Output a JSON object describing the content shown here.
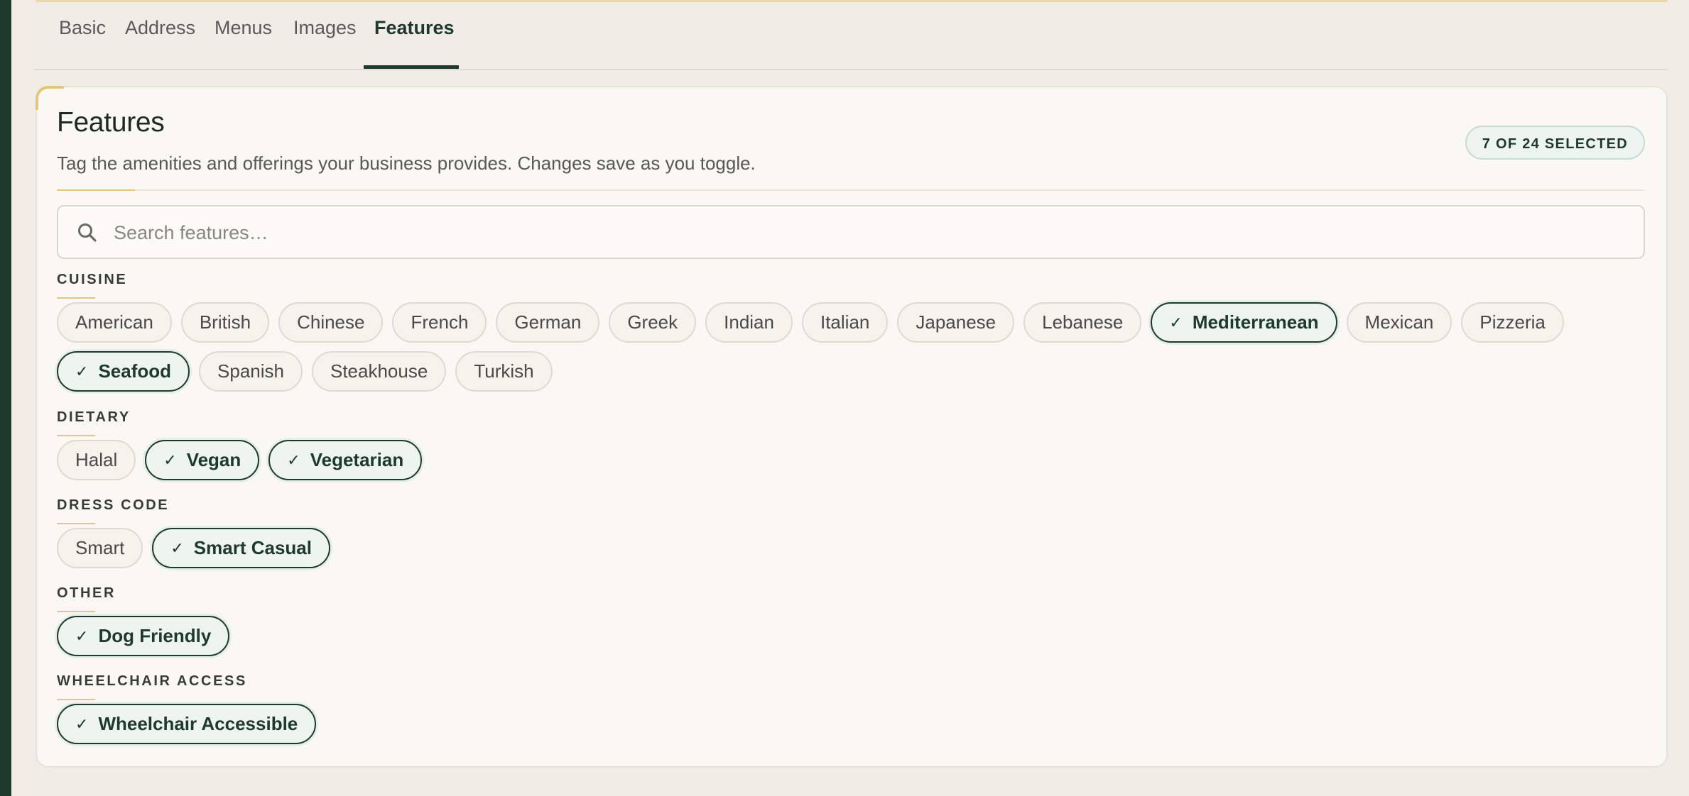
{
  "tabs": [
    {
      "label": "Basic",
      "active": false
    },
    {
      "label": "Address",
      "active": false
    },
    {
      "label": "Menus",
      "active": false
    },
    {
      "label": "Images",
      "active": false
    },
    {
      "label": "Features",
      "active": true
    }
  ],
  "card": {
    "title": "Features",
    "subtitle": "Tag the amenities and offerings your business provides. Changes save as you toggle.",
    "count_badge": "7 OF 24 SELECTED"
  },
  "search": {
    "placeholder": "Search features…",
    "value": ""
  },
  "groups": [
    {
      "label": "CUISINE",
      "chips": [
        {
          "label": "American",
          "selected": false
        },
        {
          "label": "British",
          "selected": false
        },
        {
          "label": "Chinese",
          "selected": false
        },
        {
          "label": "French",
          "selected": false
        },
        {
          "label": "German",
          "selected": false
        },
        {
          "label": "Greek",
          "selected": false
        },
        {
          "label": "Indian",
          "selected": false
        },
        {
          "label": "Italian",
          "selected": false
        },
        {
          "label": "Japanese",
          "selected": false
        },
        {
          "label": "Lebanese",
          "selected": false
        },
        {
          "label": "Mediterranean",
          "selected": true
        },
        {
          "label": "Mexican",
          "selected": false
        },
        {
          "label": "Pizzeria",
          "selected": false
        },
        {
          "label": "Seafood",
          "selected": true
        },
        {
          "label": "Spanish",
          "selected": false
        },
        {
          "label": "Steakhouse",
          "selected": false
        },
        {
          "label": "Turkish",
          "selected": false
        }
      ]
    },
    {
      "label": "DIETARY",
      "chips": [
        {
          "label": "Halal",
          "selected": false
        },
        {
          "label": "Vegan",
          "selected": true
        },
        {
          "label": "Vegetarian",
          "selected": true
        }
      ]
    },
    {
      "label": "DRESS CODE",
      "chips": [
        {
          "label": "Smart",
          "selected": false
        },
        {
          "label": "Smart Casual",
          "selected": true
        }
      ]
    },
    {
      "label": "OTHER",
      "chips": [
        {
          "label": "Dog Friendly",
          "selected": true
        }
      ]
    },
    {
      "label": "WHEELCHAIR ACCESS",
      "chips": [
        {
          "label": "Wheelchair Accessible",
          "selected": true
        }
      ]
    }
  ],
  "check_glyph": "✓",
  "colors": {
    "brand_dark": "#1e3a2b",
    "accent_gold": "#e5c57d",
    "selected_bg": "#eef4ef",
    "page_bg": "#f1ede6",
    "card_bg": "#faf8f3"
  }
}
